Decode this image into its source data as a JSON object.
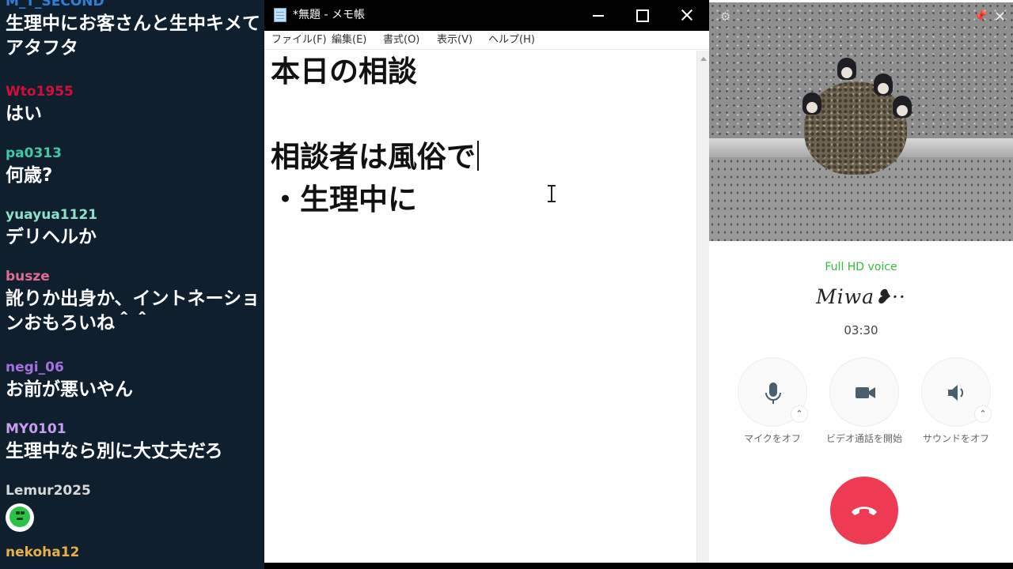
{
  "chat": {
    "messages": [
      {
        "user": "M_T_SECOND",
        "user_color": "#2f7fd6",
        "text": "生理中にお客さんと生中キメてアタフタ"
      },
      {
        "user": "Wto1955",
        "user_color": "#d0103a",
        "text": "はい"
      },
      {
        "user": "pa0313",
        "user_color": "#3fc9a4",
        "text": "何歳?"
      },
      {
        "user": "yuayua1121",
        "user_color": "#8fe0c8",
        "text": "デリヘルか"
      },
      {
        "user": "busze",
        "user_color": "#e06c92",
        "text": "訛りか出身か、イントネーションおもろいね＾＾"
      },
      {
        "user": "negi_06",
        "user_color": "#a86fe0",
        "text": "お前が悪いやん"
      },
      {
        "user": "MY0101",
        "user_color": "#c89ef0",
        "text": "生理中なら別に大丈夫だろ"
      },
      {
        "user": "Lemur2025",
        "user_color": "#d8d8d8",
        "stamp": "green-face-stamp"
      },
      {
        "user": "nekoha12",
        "user_color": "#e8b04a",
        "text": ""
      }
    ]
  },
  "notepad": {
    "title": "*無題 - メモ帳",
    "menu": [
      "ファイル(F)",
      "編集(E)",
      "書式(O)",
      "表示(V)",
      "ヘルプ(H)"
    ],
    "lines": [
      "本日の相談",
      "",
      "相談者は風俗で",
      "・生理中に"
    ]
  },
  "call": {
    "quality": "Full HD voice",
    "name": "Miwa❥··",
    "timer": "03:30",
    "controls": {
      "mic": "マイクをオフ",
      "video": "ビデオ通話を開始",
      "sound": "サウンドをオフ"
    },
    "accent_color": "#2fbe3c",
    "hangup_color": "#ee3a52"
  }
}
